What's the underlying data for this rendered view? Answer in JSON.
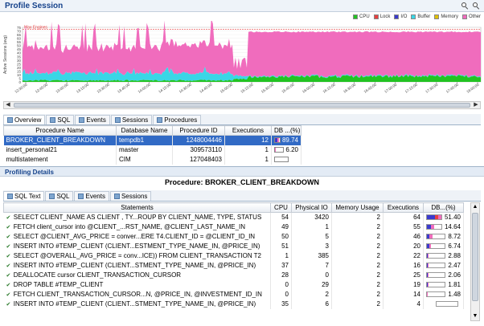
{
  "profile": {
    "title": "Profile Session",
    "max_engines_label": "Max Engines",
    "legend": [
      {
        "label": "CPU",
        "color": "#22c322"
      },
      {
        "label": "Lock",
        "color": "#e84040"
      },
      {
        "label": "I/O",
        "color": "#3a3acd"
      },
      {
        "label": "Buffer",
        "color": "#39d6e6"
      },
      {
        "label": "Memory",
        "color": "#e0c000"
      },
      {
        "label": "Other",
        "color": "#f06cbd"
      }
    ],
    "y_axis_label": "Active Sessions (avg)",
    "y_ticks": [
      "0",
      "5",
      "10",
      "15",
      "20",
      "25",
      "30",
      "35",
      "40",
      "45",
      "50",
      "55",
      "60",
      "65",
      "70",
      "75"
    ],
    "x_ticks": [
      "12:30:00",
      "12:45:00",
      "13:00:00",
      "13:15:00",
      "13:30:00",
      "13:45:00",
      "14:00:00",
      "14:15:00",
      "14:30:00",
      "14:45:00",
      "15:00:00",
      "15:15:00",
      "15:30:00",
      "15:45:00",
      "16:00:00",
      "16:15:00",
      "16:30:00",
      "16:45:00",
      "17:00:00",
      "17:15:00",
      "17:30:00",
      "17:45:00",
      "18:00:00"
    ]
  },
  "top_tabs": [
    {
      "label": "Overview",
      "icon": "overview-icon",
      "active": true
    },
    {
      "label": "SQL",
      "icon": "sql-icon",
      "active": false
    },
    {
      "label": "Events",
      "icon": "events-icon",
      "active": false
    },
    {
      "label": "Sessions",
      "icon": "sessions-icon",
      "active": false
    },
    {
      "label": "Procedures",
      "icon": "procedures-icon",
      "active": false
    }
  ],
  "proc_table": {
    "headers": [
      "Procedure Name",
      "Database Name",
      "Procedure ID",
      "Executions",
      "DB ...(%)"
    ],
    "rows": [
      {
        "name": "BROKER_CLIENT_BREAKDOWN",
        "db": "tempdb1",
        "id": "1248004446",
        "exec": "12",
        "pct": "89.74",
        "selected": true
      },
      {
        "name": "insert_personal21",
        "db": "master",
        "id": "309573110",
        "exec": "1",
        "pct": "6.20",
        "selected": false
      },
      {
        "name": "multistatement",
        "db": "CIM",
        "id": "127048403",
        "exec": "1",
        "pct": "",
        "selected": false
      }
    ]
  },
  "details": {
    "title": "Profiling Details",
    "procedure_label": "Procedure: BROKER_CLIENT_BREAKDOWN",
    "tabs": [
      {
        "label": "SQL Text",
        "active": true
      },
      {
        "label": "SQL",
        "active": false
      },
      {
        "label": "Events",
        "active": false
      },
      {
        "label": "Sessions",
        "active": false
      }
    ],
    "headers": [
      "Statements",
      "CPU",
      "Physical IO",
      "Memory Usage",
      "Executions",
      "DB...(%)"
    ],
    "rows": [
      {
        "stmt": "SELECT CLIENT_NAME AS CLIENT , TY...ROUP BY CLIENT_NAME, TYPE, STATUS",
        "cpu": "54",
        "pio": "3420",
        "mem": "2",
        "exec": "64",
        "pct": "51.40",
        "bar": [
          0.55,
          0.25,
          0.2
        ]
      },
      {
        "stmt": "FETCH client_cursor into @CLIENT_...RST_NAME, @CLIENT_LAST_NAME_IN",
        "cpu": "49",
        "pio": "1",
        "mem": "2",
        "exec": "55",
        "pct": "14.64",
        "bar": [
          0.3,
          0.0,
          0.2
        ]
      },
      {
        "stmt": "SELECT @CLIENT_AVG_PRICE = conver...ERE T4.CLIENT_ID = @CLIENT_ID_IN",
        "cpu": "50",
        "pio": "5",
        "mem": "2",
        "exec": "46",
        "pct": "8.72",
        "bar": [
          0.15,
          0.0,
          0.15
        ]
      },
      {
        "stmt": "INSERT INTO #TEMP_CLIENT (CLIENT...ESTMENT_TYPE_NAME_IN, @PRICE_IN)",
        "cpu": "51",
        "pio": "3",
        "mem": "2",
        "exec": "20",
        "pct": "6.74",
        "bar": [
          0.12,
          0.0,
          0.12
        ]
      },
      {
        "stmt": "SELECT @OVERALL_AVG_PRICE = conv...ICE)) FROM CLIENT_TRANSACTION T2",
        "cpu": "1",
        "pio": "385",
        "mem": "2",
        "exec": "22",
        "pct": "2.88",
        "bar": [
          0.05,
          0.0,
          0.05
        ]
      },
      {
        "stmt": "INSERT INTO #TEMP_CLIENT (CLIENT...STMENT_TYPE_NAME_IN, @PRICE_IN)",
        "cpu": "37",
        "pio": "7",
        "mem": "2",
        "exec": "16",
        "pct": "2.47",
        "bar": [
          0.04,
          0.0,
          0.05
        ]
      },
      {
        "stmt": "DEALLOCATE cursor CLIENT_TRANSACTION_CURSOR",
        "cpu": "28",
        "pio": "0",
        "mem": "2",
        "exec": "25",
        "pct": "2.06",
        "bar": [
          0.03,
          0.0,
          0.04
        ]
      },
      {
        "stmt": "DROP TABLE #TEMP_CLIENT",
        "cpu": "0",
        "pio": "29",
        "mem": "2",
        "exec": "19",
        "pct": "1.81",
        "bar": [
          0.03,
          0.0,
          0.03
        ]
      },
      {
        "stmt": "FETCH CLIENT_TRANSACTION_CURSOR...N, @PRICE_IN, @INVESTMENT_ID_IN",
        "cpu": "0",
        "pio": "2",
        "mem": "2",
        "exec": "14",
        "pct": "1.48",
        "bar": [
          0.02,
          0.0,
          0.03
        ]
      },
      {
        "stmt": "INSERT INTO #TEMP_CLIENT (CLIENT...STMENT_TYPE_NAME_IN, @PRICE_IN)",
        "cpu": "35",
        "pio": "6",
        "mem": "2",
        "exec": "4",
        "pct": "",
        "bar": [
          0.0,
          0.0,
          0.0
        ]
      }
    ]
  }
}
